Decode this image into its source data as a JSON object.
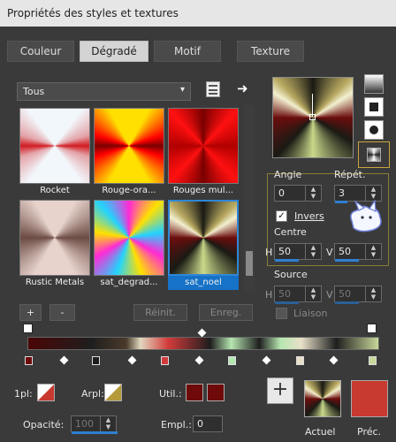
{
  "window": {
    "title": "Propriétés des styles et textures"
  },
  "tabs": {
    "couleur": "Couleur",
    "degrade": "Dégradé",
    "motif": "Motif",
    "texture": "Texture"
  },
  "library": {
    "category": "Tous",
    "items": [
      {
        "label": "Rocket"
      },
      {
        "label": "Rouge-ora..."
      },
      {
        "label": "Rouges mul..."
      },
      {
        "label": "Rustic Metals"
      },
      {
        "label": "sat_degrad..."
      },
      {
        "label": "sat_noel"
      }
    ],
    "buttons": {
      "add": "+",
      "remove": "-",
      "reset": "Réinit.",
      "save": "Enreg."
    }
  },
  "settings": {
    "angle_label": "Angle",
    "angle_value": "0",
    "repeat_label": "Répét.",
    "repeat_value": "3",
    "invert_label": "Invers",
    "center_label": "Centre",
    "center_h_label": "H",
    "center_h_value": "50",
    "center_v_label": "V",
    "center_v_value": "50",
    "source_label": "Source",
    "source_h_label": "H",
    "source_h_value": "50",
    "source_v_label": "V",
    "source_v_value": "50",
    "link_label": "Liaison"
  },
  "bottom": {
    "fg_label": "1pl:",
    "bg_label": "Arpl:",
    "user_label": "Util.:",
    "opacity_label": "Opacité:",
    "opacity_value": "100",
    "position_label": "Empl.:",
    "position_value": "0",
    "add_button": "+",
    "current_label": "Actuel",
    "previous_label": "Préc."
  },
  "colors": {
    "accent": "#2f7fd0",
    "selection_border": "#8d7b34",
    "stop_dark_red": "#6e0a0a",
    "stop_red": "#d23a3a",
    "stop_green": "#b6e6b0",
    "previous": "#c8392f"
  }
}
